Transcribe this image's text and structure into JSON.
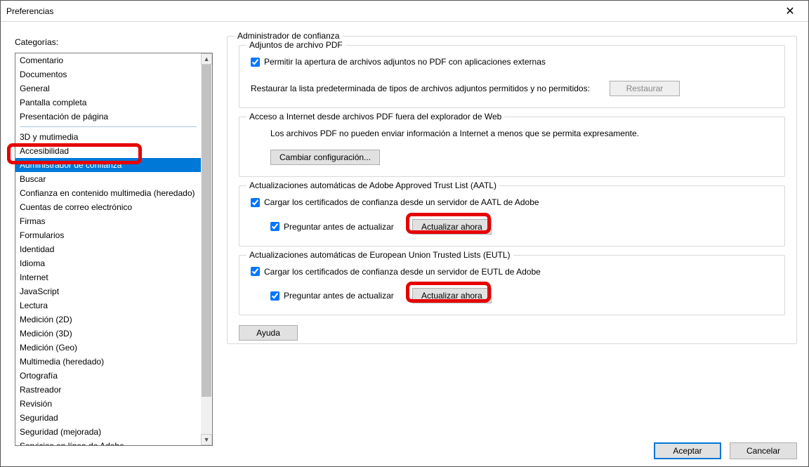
{
  "window": {
    "title": "Preferencias"
  },
  "categories": {
    "label": "Categorías:",
    "group1": [
      "Comentario",
      "Documentos",
      "General",
      "Pantalla completa",
      "Presentación de página"
    ],
    "group2": [
      "3D y mutimedia",
      "Accesibilidad",
      "Administrador de confianza",
      "Buscar",
      "Confianza en contenido multimedia (heredado)",
      "Cuentas de correo electrónico",
      "Firmas",
      "Formularios",
      "Identidad",
      "Idioma",
      "Internet",
      "JavaScript",
      "Lectura",
      "Medición (2D)",
      "Medición (3D)",
      "Medición (Geo)",
      "Multimedia (heredado)",
      "Ortografía",
      "Rastreador",
      "Revisión",
      "Seguridad",
      "Seguridad (mejorada)",
      "Servicios en línea de Adobe"
    ],
    "selected": "Administrador de confianza"
  },
  "trust": {
    "legend": "Administrador de confianza",
    "pdf_attach": {
      "legend": "Adjuntos de archivo PDF",
      "allow_open": "Permitir la apertura de archivos adjuntos no PDF con aplicaciones externas",
      "restore_text": "Restaurar la lista predeterminada de tipos de archivos adjuntos permitidos y no permitidos:",
      "restore_btn": "Restaurar"
    },
    "internet": {
      "legend": "Acceso a Internet desde archivos PDF fuera del explorador de Web",
      "desc": "Los archivos PDF no pueden enviar información a Internet a menos que se permita expresamente.",
      "change_btn": "Cambiar configuración..."
    },
    "aatl": {
      "legend": "Actualizaciones automáticas de Adobe Approved Trust List (AATL)",
      "load": "Cargar los certificados de confianza desde un servidor de AATL de Adobe",
      "ask": "Preguntar antes de actualizar",
      "update_btn": "Actualizar ahora"
    },
    "eutl": {
      "legend": "Actualizaciones automáticas de European Union Trusted Lists (EUTL)",
      "load": "Cargar los certificados de confianza desde un servidor de EUTL de Adobe",
      "ask": "Preguntar antes de actualizar",
      "update_btn": "Actualizar ahora"
    },
    "help_btn": "Ayuda"
  },
  "buttons": {
    "ok": "Aceptar",
    "cancel": "Cancelar"
  }
}
